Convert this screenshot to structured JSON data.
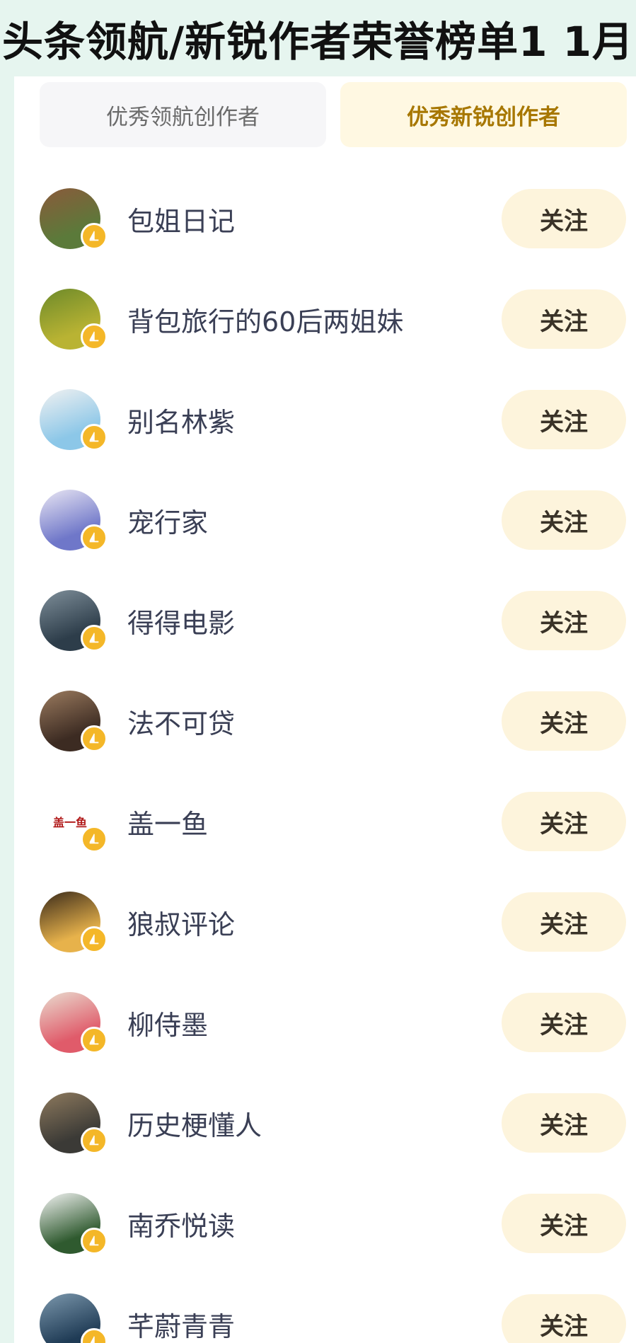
{
  "banner": {
    "title": "头条领航/新锐作者荣誉榜单1 1月"
  },
  "tabs": [
    {
      "label": "优秀领航创作者",
      "active": false
    },
    {
      "label": "优秀新锐创作者",
      "active": true
    }
  ],
  "authors": [
    {
      "name": "包姐日记",
      "follow_label": "关注",
      "avatar_colors": [
        "#5b7a3a",
        "#8a5a3b"
      ]
    },
    {
      "name": "背包旅行的60后两姐妹",
      "follow_label": "关注",
      "avatar_colors": [
        "#b9b333",
        "#6d8a2a"
      ]
    },
    {
      "name": "别名林紫",
      "follow_label": "关注",
      "avatar_colors": [
        "#8cc7e8",
        "#f1f1f1"
      ]
    },
    {
      "name": "宠行家",
      "follow_label": "关注",
      "avatar_colors": [
        "#6f77c9",
        "#e9e6f3"
      ]
    },
    {
      "name": "得得电影",
      "follow_label": "关注",
      "avatar_colors": [
        "#2d3d4a",
        "#7f8f9a"
      ]
    },
    {
      "name": "法不可贷",
      "follow_label": "关注",
      "avatar_colors": [
        "#3c2b22",
        "#9b7b5f"
      ]
    },
    {
      "name": "盖一鱼",
      "follow_label": "关注",
      "avatar_text": "盖一鱼"
    },
    {
      "name": "狼叔评论",
      "follow_label": "关注",
      "avatar_colors": [
        "#e7b24b",
        "#3a2a1a"
      ]
    },
    {
      "name": "柳侍墨",
      "follow_label": "关注",
      "avatar_colors": [
        "#e05b6a",
        "#e9ddd0"
      ]
    },
    {
      "name": "历史梗懂人",
      "follow_label": "关注",
      "avatar_colors": [
        "#3b3a36",
        "#8e7a5e"
      ]
    },
    {
      "name": "南乔悦读",
      "follow_label": "关注",
      "avatar_colors": [
        "#2f5a2f",
        "#f4f4f4"
      ]
    },
    {
      "name": "芊蔚青青",
      "follow_label": "关注",
      "avatar_colors": [
        "#1f3b55",
        "#7c98ad"
      ]
    }
  ],
  "colors": {
    "accent": "#a77700",
    "follow_bg": "#fdf4dc",
    "badge": "#f4b728"
  }
}
